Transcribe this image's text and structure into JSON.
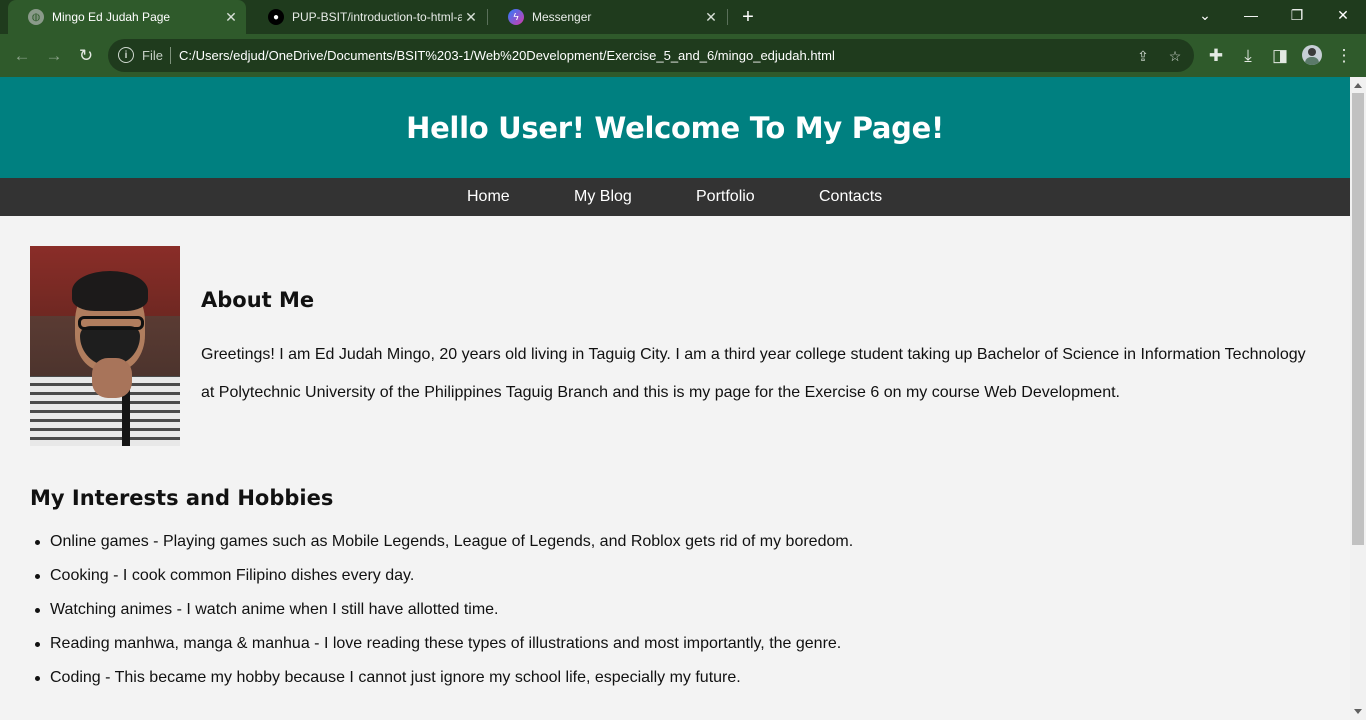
{
  "browser": {
    "tabs": [
      {
        "title": "Mingo Ed Judah Page",
        "icon": "globe-icon",
        "active": true
      },
      {
        "title": "PUP-BSIT/introduction-to-html-a",
        "icon": "github-icon",
        "active": false
      },
      {
        "title": "Messenger",
        "icon": "messenger-icon",
        "active": false
      }
    ],
    "address": {
      "scheme": "File",
      "url": "C:/Users/edjud/OneDrive/Documents/BSIT%203-1/Web%20Development/Exercise_5_and_6/mingo_edjudah.html"
    },
    "colors": {
      "frame": "#1f3b1d",
      "toolbar": "#2f5a2b"
    }
  },
  "page": {
    "header_title": "Hello User! Welcome To My Page!",
    "nav": [
      "Home",
      "My Blog",
      "Portfolio",
      "Contacts"
    ],
    "about": {
      "title": "About Me",
      "text": "Greetings! I am Ed Judah Mingo, 20 years old living in Taguig City. I am a third year college student taking up Bachelor of Science in Information Technology at Polytechnic University of the Philippines Taguig Branch and this is my page for the Exercise 6 on my course Web Development."
    },
    "interests": {
      "title": "My Interests and Hobbies",
      "items": [
        "Online games - Playing games such as Mobile Legends, League of Legends, and Roblox gets rid of my boredom.",
        "Cooking - I cook common Filipino dishes every day.",
        "Watching animes - I watch anime when I still have allotted time.",
        "Reading manhwa, manga & manhua - I love reading these types of illustrations and most importantly, the genre.",
        "Coding - This became my hobby because I cannot just ignore my school life, especially my future."
      ]
    },
    "colors": {
      "header": "#008080",
      "nav": "#333333",
      "background": "#f3f3f3"
    }
  }
}
